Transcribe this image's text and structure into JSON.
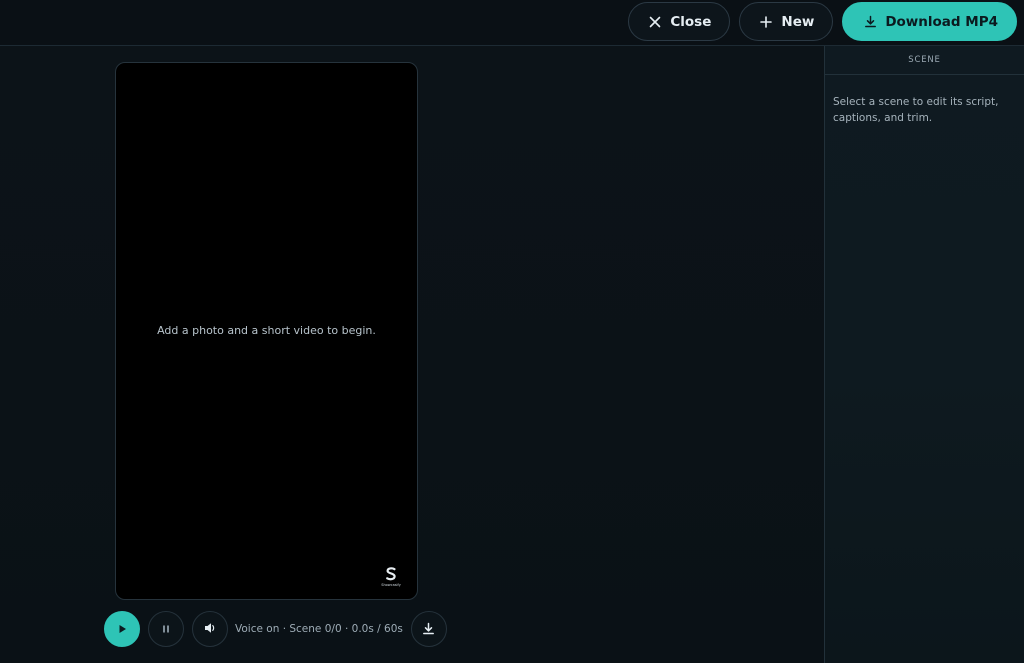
{
  "toolbar": {
    "close_label": "Close",
    "new_label": "New",
    "download_label": "Download MP4",
    "accent_color": "#2ec4b6"
  },
  "preview": {
    "empty_message": "Add a photo and a short video to begin.",
    "watermark_text": "Showcasify"
  },
  "player": {
    "status_text": "Voice on · Scene 0/0 · 0.0s / 60s",
    "icons": [
      "play-icon",
      "pause-icon",
      "volume-icon",
      "download-icon"
    ]
  },
  "scene_panel": {
    "title": "SCENE",
    "hint": "Select a scene to edit its script, captions, and trim."
  }
}
